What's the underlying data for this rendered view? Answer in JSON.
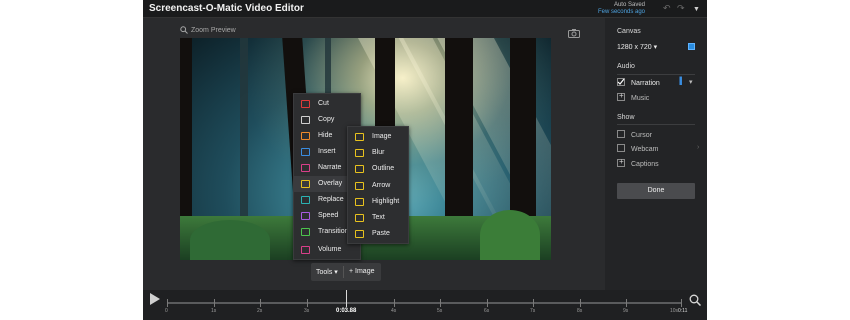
{
  "app": {
    "title": "Screencast-O-Matic Video Editor",
    "autosave_label": "Auto Saved",
    "autosave_time": "Few seconds ago"
  },
  "preview": {
    "zoom_label": "Zoom Preview"
  },
  "tools_menu": {
    "col1": [
      {
        "label": "Cut",
        "icon": "cut-icon",
        "color": "#e03a3a"
      },
      {
        "label": "Copy",
        "icon": "copy-icon",
        "color": "#d0d0d0"
      },
      {
        "label": "Hide",
        "icon": "hide-icon",
        "color": "#f08a2a"
      },
      {
        "label": "Insert",
        "icon": "insert-icon",
        "color": "#3a8de0"
      },
      {
        "label": "Narrate",
        "icon": "narrate-icon",
        "color": "#d93f8a"
      },
      {
        "label": "Overlay",
        "icon": "overlay-icon",
        "color": "#e8c21e"
      },
      {
        "label": "Replace",
        "icon": "replace-icon",
        "color": "#2bb3b3"
      },
      {
        "label": "Speed",
        "icon": "speed-icon",
        "color": "#a85ae0"
      },
      {
        "label": "Transition",
        "icon": "transition-icon",
        "color": "#4cc44c"
      },
      {
        "label": "Volume",
        "icon": "volume-icon",
        "color": "#d93f8a"
      }
    ],
    "col2": [
      {
        "label": "Image",
        "icon": "image-icon",
        "color": "#e8c21e"
      },
      {
        "label": "Blur",
        "icon": "blur-icon",
        "color": "#e8c21e"
      },
      {
        "label": "Outline",
        "icon": "outline-icon",
        "color": "#e8c21e"
      },
      {
        "label": "Arrow",
        "icon": "arrow-icon",
        "color": "#e8c21e"
      },
      {
        "label": "Highlight",
        "icon": "highlight-icon",
        "color": "#e8c21e"
      },
      {
        "label": "Text",
        "icon": "text-icon",
        "color": "#e8c21e"
      },
      {
        "label": "Paste",
        "icon": "paste-icon",
        "color": "#e8c21e"
      }
    ]
  },
  "toolbar": {
    "tools_label": "Tools",
    "image_label": "+ Image"
  },
  "timeline": {
    "current_time": "0:03.88",
    "end_time": "0:11",
    "ticks": [
      "0",
      "1s",
      "2s",
      "3s",
      "4s",
      "5s",
      "6s",
      "7s",
      "8s",
      "9s",
      "10s",
      "0:11"
    ]
  },
  "sidebar": {
    "canvas_heading": "Canvas",
    "canvas_size": "1280 x 720",
    "audio_heading": "Audio",
    "narration_label": "Narration",
    "music_label": "Music",
    "show_heading": "Show",
    "cursor_label": "Cursor",
    "webcam_label": "Webcam",
    "captions_label": "Captions",
    "done_label": "Done"
  },
  "colors": {
    "accent": "#2a8de0",
    "background": "#232426"
  }
}
